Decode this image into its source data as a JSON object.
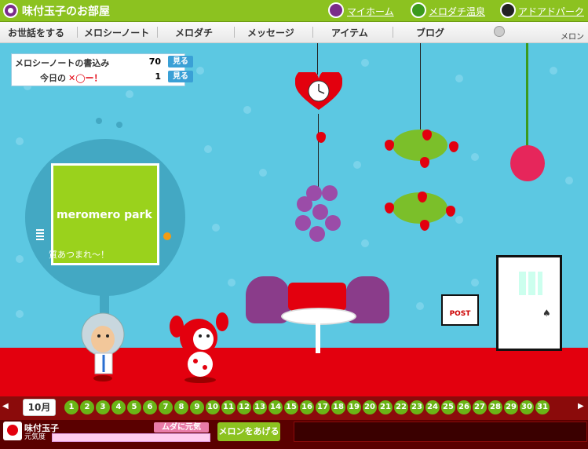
{
  "header": {
    "site_title": "味付玉子のお部屋",
    "links": [
      {
        "label": "マイホーム",
        "icon": "purple-face-icon",
        "color": "#7a2c8a"
      },
      {
        "label": "メロダチ温泉",
        "icon": "green-face-icon",
        "color": "#3c9a1c"
      },
      {
        "label": "アドアドパーク",
        "icon": "black-face-icon",
        "color": "#222222"
      }
    ]
  },
  "nav": {
    "items": [
      "お世話をする",
      "メロシーノート",
      "メロダチ",
      "メッセージ",
      "アイテム",
      "ブログ"
    ],
    "melon_label": "メロン"
  },
  "info": {
    "rows": [
      {
        "label": "メロシーノートの書込み",
        "value": "70",
        "button": "見る"
      },
      {
        "label": "今日の",
        "value": "1",
        "button": "見る"
      }
    ]
  },
  "tv": {
    "logo": "meromero park",
    "ticker": "質あつまれ〜！"
  },
  "decor": {
    "post_label": "POST"
  },
  "calendar": {
    "month": "10月",
    "days": [
      "1",
      "2",
      "3",
      "4",
      "5",
      "6",
      "7",
      "8",
      "9",
      "10",
      "11",
      "12",
      "13",
      "14",
      "15",
      "16",
      "17",
      "18",
      "19",
      "20",
      "21",
      "22",
      "23",
      "24",
      "25",
      "26",
      "27",
      "28",
      "29",
      "30",
      "31"
    ]
  },
  "status": {
    "name": "味付玉子",
    "mood": "元気度",
    "mood_badge": "ムダに元気",
    "give_button": "メロンをあげる"
  },
  "colors": {
    "header_green": "#8cc220",
    "room_blue": "#5cc8e2",
    "floor_red": "#e3000e",
    "calendar_bar": "#8b0b0b"
  }
}
